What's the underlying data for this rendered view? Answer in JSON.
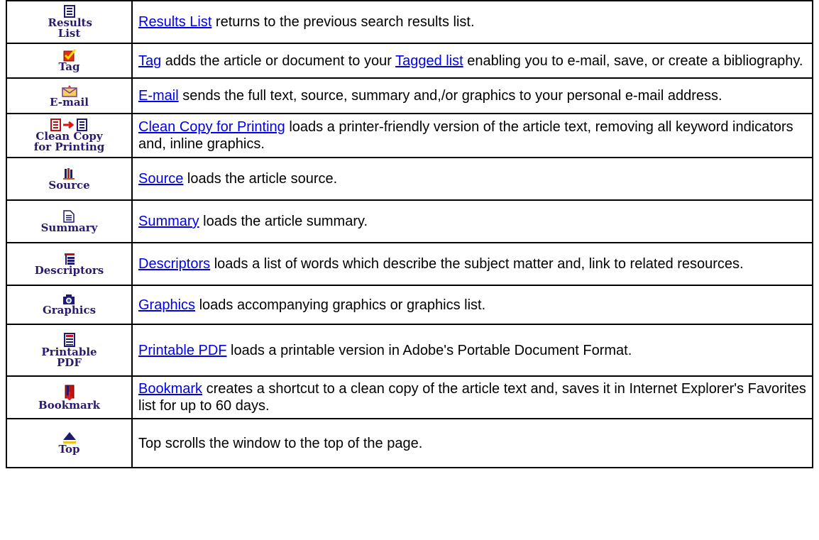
{
  "rows": [
    {
      "icon": "results-list-icon",
      "button_label": "Results List",
      "link": "Results List",
      "text": " returns to the previous search results list."
    },
    {
      "icon": "tag-checkbox-icon",
      "button_label": "Tag",
      "link": "Tag",
      "text_a": " adds the article or document to your ",
      "link2": "Tagged list",
      "text_b": " enabling you to e-mail, save, or create a bibliography."
    },
    {
      "icon": "envelope-icon",
      "button_label": "E-mail",
      "link": "E-mail",
      "text": " sends the full text, source, summary and,/or graphics to your personal e-mail address."
    },
    {
      "icon": "clean-copy-icon",
      "button_label": "Clean Copy for Printing",
      "link": "Clean Copy for Printing",
      "text": " loads a printer-friendly version of the article text, removing all keyword indicators and, inline graphics."
    },
    {
      "icon": "books-icon",
      "button_label": "Source",
      "link": "Source",
      "text": " loads the article source."
    },
    {
      "icon": "document-icon",
      "button_label": "Summary",
      "link": "Summary",
      "text": " loads the article summary."
    },
    {
      "icon": "tree-list-icon",
      "button_label": "Descriptors",
      "link": "Descriptors",
      "text": " loads a list of words which describe the subject matter and, link to related resources."
    },
    {
      "icon": "camera-icon",
      "button_label": "Graphics",
      "link": "Graphics",
      "text": " loads accompanying graphics or graphics list."
    },
    {
      "icon": "pdf-document-icon",
      "button_label": "Printable PDF",
      "link": "Printable PDF",
      "text": " loads a printable version in Adobe's Portable Document Format."
    },
    {
      "icon": "bookmark-icon",
      "button_label": "Bookmark",
      "link": "Bookmark",
      "text": " creates a shortcut to a clean copy of the article text and, saves it in Internet Explorer's Favorites list for up to 60 days."
    },
    {
      "icon": "arrow-up-icon",
      "button_label": "Top",
      "text": "Top scrolls the window to the top of the page."
    }
  ]
}
